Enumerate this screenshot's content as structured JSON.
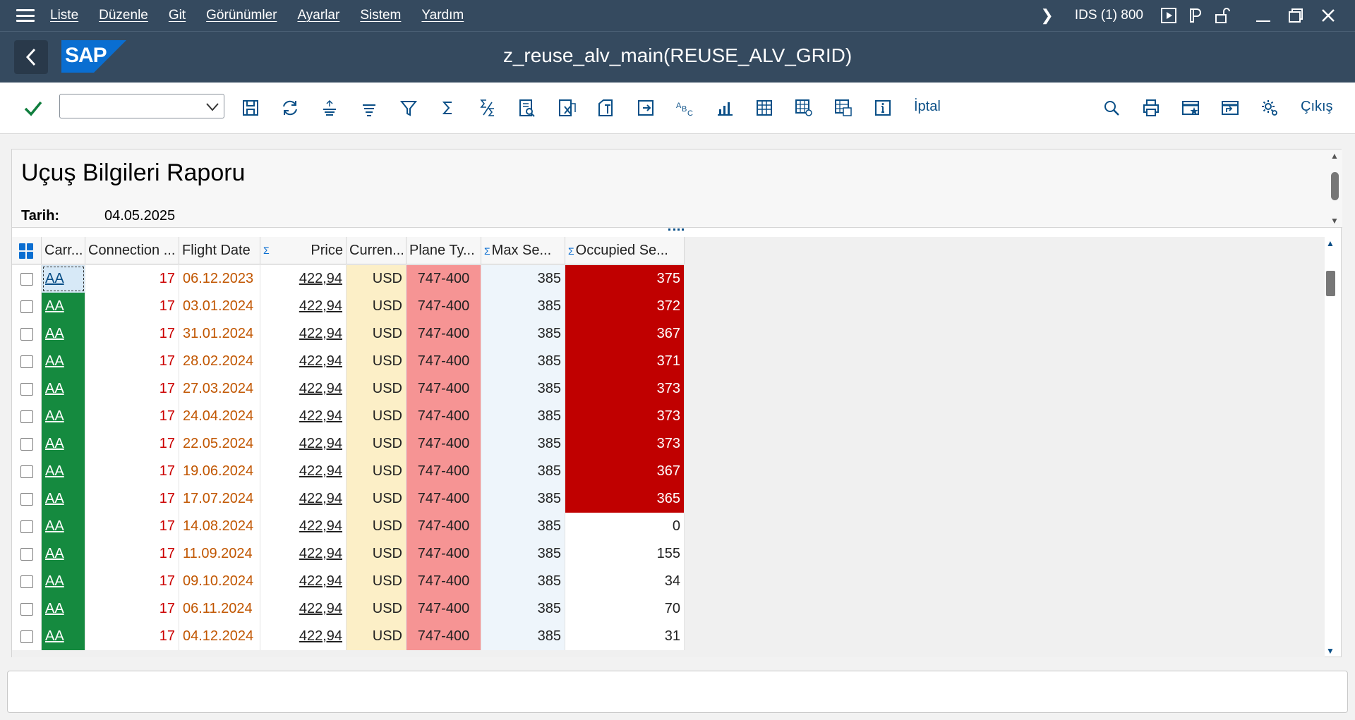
{
  "menu": {
    "items": [
      "Liste",
      "Düzenle",
      "Git",
      "Görünümler",
      "Ayarlar",
      "Sistem",
      "Yardım"
    ],
    "system_info": "IDS (1) 800"
  },
  "titlebar": {
    "logo_text": "SAP",
    "title": "z_reuse_alv_main(REUSE_ALV_GRID)"
  },
  "toolbar": {
    "command_value": "",
    "cancel_label": "İptal",
    "exit_label": "Çıkış"
  },
  "report": {
    "title": "Uçuş Bilgileri Raporu",
    "date_label": "Tarih:",
    "date_value": "04.05.2025"
  },
  "grid": {
    "columns": {
      "carrier": "Carr...",
      "connection": "Connection ...",
      "flight_date": "Flight Date",
      "price": "Price",
      "currency": "Curren...",
      "plane_type": "Plane Ty...",
      "max_seats": "Max Se...",
      "occupied_seats": "Occupied Se..."
    },
    "rows": [
      {
        "carrier": "AA",
        "connection": "17",
        "date": "06.12.2023",
        "price": "422,94",
        "currency": "USD",
        "plane": "747-400",
        "max": "385",
        "occupied": "375",
        "highlight": true
      },
      {
        "carrier": "AA",
        "connection": "17",
        "date": "03.01.2024",
        "price": "422,94",
        "currency": "USD",
        "plane": "747-400",
        "max": "385",
        "occupied": "372",
        "highlight": true
      },
      {
        "carrier": "AA",
        "connection": "17",
        "date": "31.01.2024",
        "price": "422,94",
        "currency": "USD",
        "plane": "747-400",
        "max": "385",
        "occupied": "367",
        "highlight": true
      },
      {
        "carrier": "AA",
        "connection": "17",
        "date": "28.02.2024",
        "price": "422,94",
        "currency": "USD",
        "plane": "747-400",
        "max": "385",
        "occupied": "371",
        "highlight": true
      },
      {
        "carrier": "AA",
        "connection": "17",
        "date": "27.03.2024",
        "price": "422,94",
        "currency": "USD",
        "plane": "747-400",
        "max": "385",
        "occupied": "373",
        "highlight": true
      },
      {
        "carrier": "AA",
        "connection": "17",
        "date": "24.04.2024",
        "price": "422,94",
        "currency": "USD",
        "plane": "747-400",
        "max": "385",
        "occupied": "373",
        "highlight": true
      },
      {
        "carrier": "AA",
        "connection": "17",
        "date": "22.05.2024",
        "price": "422,94",
        "currency": "USD",
        "plane": "747-400",
        "max": "385",
        "occupied": "373",
        "highlight": true
      },
      {
        "carrier": "AA",
        "connection": "17",
        "date": "19.06.2024",
        "price": "422,94",
        "currency": "USD",
        "plane": "747-400",
        "max": "385",
        "occupied": "367",
        "highlight": true
      },
      {
        "carrier": "AA",
        "connection": "17",
        "date": "17.07.2024",
        "price": "422,94",
        "currency": "USD",
        "plane": "747-400",
        "max": "385",
        "occupied": "365",
        "highlight": true
      },
      {
        "carrier": "AA",
        "connection": "17",
        "date": "14.08.2024",
        "price": "422,94",
        "currency": "USD",
        "plane": "747-400",
        "max": "385",
        "occupied": "0",
        "highlight": false
      },
      {
        "carrier": "AA",
        "connection": "17",
        "date": "11.09.2024",
        "price": "422,94",
        "currency": "USD",
        "plane": "747-400",
        "max": "385",
        "occupied": "155",
        "highlight": false
      },
      {
        "carrier": "AA",
        "connection": "17",
        "date": "09.10.2024",
        "price": "422,94",
        "currency": "USD",
        "plane": "747-400",
        "max": "385",
        "occupied": "34",
        "highlight": false
      },
      {
        "carrier": "AA",
        "connection": "17",
        "date": "06.11.2024",
        "price": "422,94",
        "currency": "USD",
        "plane": "747-400",
        "max": "385",
        "occupied": "70",
        "highlight": false
      },
      {
        "carrier": "AA",
        "connection": "17",
        "date": "04.12.2024",
        "price": "422,94",
        "currency": "USD",
        "plane": "747-400",
        "max": "385",
        "occupied": "31",
        "highlight": false
      }
    ]
  },
  "colors": {
    "shell": "#354a5f",
    "carrier_cell": "#158a3f",
    "plane_cell": "#f69494",
    "currency_cell": "#fcefc7",
    "occupied_alert": "#c00000",
    "accent": "#0a4f87"
  }
}
